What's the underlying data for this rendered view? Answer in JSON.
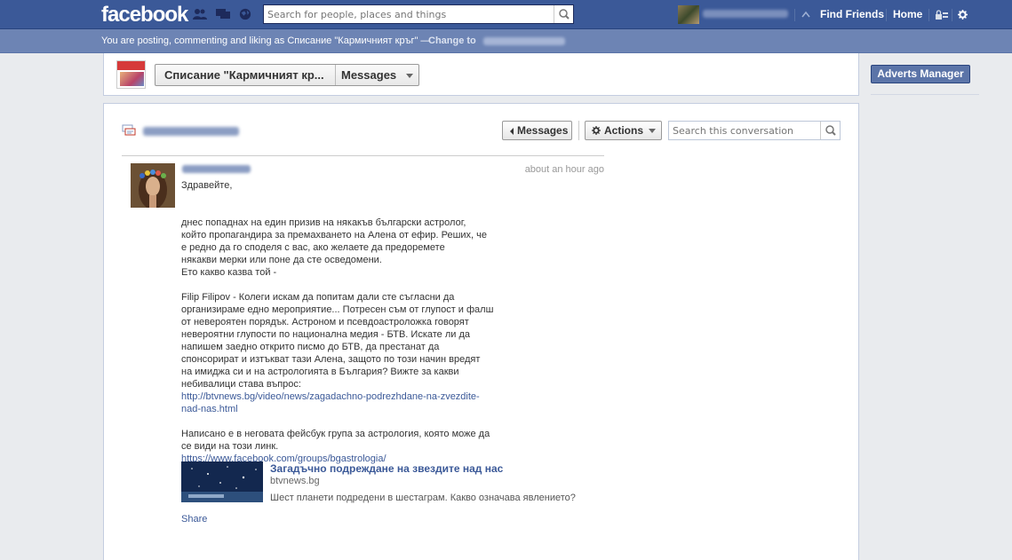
{
  "topbar": {
    "logo": "facebook",
    "search_placeholder": "Search for people, places and things",
    "find_friends": "Find Friends",
    "home": "Home"
  },
  "posting_bar": {
    "text": "You are posting, commenting and liking as Списание \"Кармичният кръг\" —",
    "change_label": "Change to"
  },
  "page_header": {
    "page_name": "Списание \"Кармичният кр...",
    "section": "Messages"
  },
  "right_column": {
    "adverts_manager": "Adverts Manager"
  },
  "conversation": {
    "back_button": "Messages",
    "actions_button": "Actions",
    "search_placeholder": "Search this conversation"
  },
  "message": {
    "time": "about an hour ago",
    "greeting": "Здравейте,",
    "para1": [
      "днес попаднах на един призив на някакъв български астролог,",
      "който пропагандира за премахването на Алена от ефир. Реших, че",
      "е редно да го споделя с вас, ако желаете да предоремете",
      "някакви мерки или поне да сте осведомени.",
      "Ето какво казва той -"
    ],
    "para2": [
      "Filip Filipov - Колеги искам да попитам дали сте съгласни да",
      "организираме едно мероприятие... Потресен съм от глупост и фалш",
      "от невероятен порядък. Астроном и псевдоастроложка говорят",
      "невероятни глупости по национална медия - БТВ. Искате ли да",
      "напишем заедно открито писмо до БТВ, да престанат да",
      "спонсорират и изтъкват тази Алена, защото по този начин вредят",
      "на имиджа си и на астрологията в България? Вижте за какви",
      "небивалици става въпрос:"
    ],
    "link1_line1": "http://btvnews.bg/video/news/zagadachno-podrezhdane-na-zvezdite-",
    "link1_line2": "nad-nas.html",
    "para3": [
      "Написано е в неговата фейсбук група за астрология, която може да",
      "се види на този линк."
    ],
    "link2": "https://www.facebook.com/groups/bgastrologia/",
    "share": {
      "title": "Загадъчно подреждане на звездите над нас",
      "domain": "btvnews.bg",
      "description": "Шест планети подредени в шестаграм. Какво означава явлението?"
    },
    "share_link": "Share"
  },
  "colors": {
    "brand": "#3b5998",
    "posting_bar": "#6d84b4",
    "page_bg": "#e9ebee",
    "link": "#3b5998"
  }
}
